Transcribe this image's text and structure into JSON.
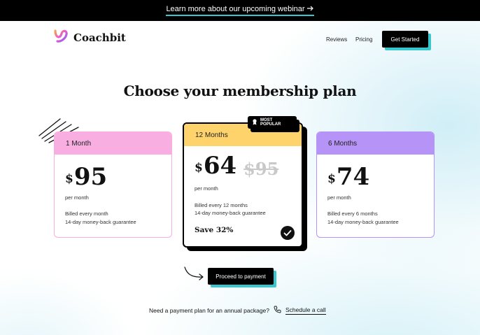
{
  "banner": {
    "text": "Learn more about our upcoming webinar",
    "arrow_icon": "arrow-right-icon"
  },
  "nav": {
    "brand": "Coachbit",
    "links": [
      "Reviews",
      "Pricing"
    ],
    "cta": "Get Started"
  },
  "headline": "Choose your membership plan",
  "colors": {
    "accent_teal": "#38c6cf",
    "pink": "#f9aee2",
    "yellow": "#ffd36b",
    "purple": "#b693f6"
  },
  "plans": [
    {
      "name": "1 Month",
      "currency": "$",
      "price": "95",
      "per": "per month",
      "billing": "Billed every month",
      "guarantee": "14-day money-back guarantee"
    },
    {
      "name": "12 Months",
      "badge": "MOST POPULAR",
      "currency": "$",
      "price": "64",
      "old_price": "$95",
      "per": "per month",
      "billing": "Billed every 12 months",
      "guarantee": "14-day money-back guarantee",
      "save": "Save 32%",
      "selected": true
    },
    {
      "name": "6 Months",
      "currency": "$",
      "price": "74",
      "per": "per month",
      "billing": "Billed every 6 months",
      "guarantee": "14-day money-back guarantee"
    }
  ],
  "proceed": "Proceed to payment",
  "footer": {
    "question": "Need a payment plan for an annual package?",
    "link": "Schedule a call"
  }
}
